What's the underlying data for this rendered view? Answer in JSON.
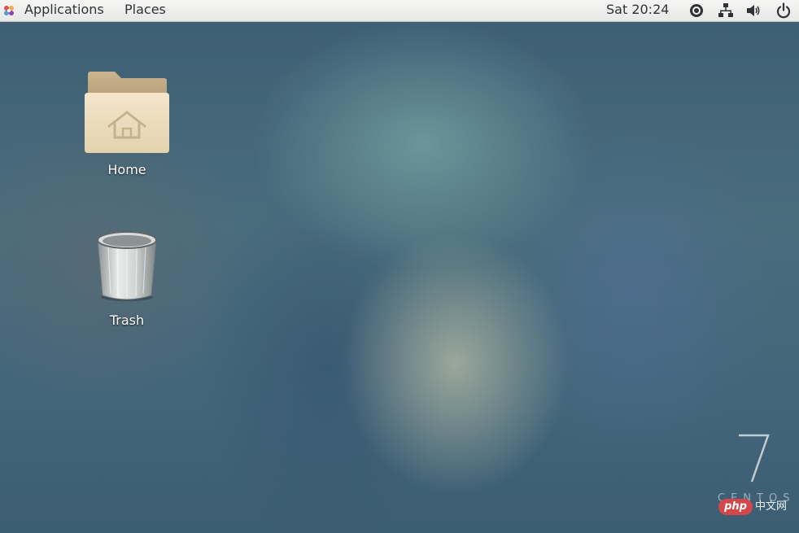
{
  "topbar": {
    "applications_label": "Applications",
    "places_label": "Places",
    "clock": "Sat 20:24",
    "icons": [
      "accessibility-icon",
      "network-icon",
      "volume-icon",
      "power-icon"
    ]
  },
  "desktop": {
    "items": [
      {
        "label": "Home",
        "icon": "home-folder-icon"
      },
      {
        "label": "Trash",
        "icon": "trash-icon"
      }
    ],
    "branding": {
      "version": "7",
      "name": "CENTOS"
    }
  },
  "watermark": {
    "badge": "php",
    "text": "中文网"
  },
  "colors": {
    "topbar": "#ececec",
    "text": "#2e3436",
    "folder": "#e7d6b4",
    "wallpaper": "#4a6d7c",
    "php_badge": "#d3474b"
  }
}
